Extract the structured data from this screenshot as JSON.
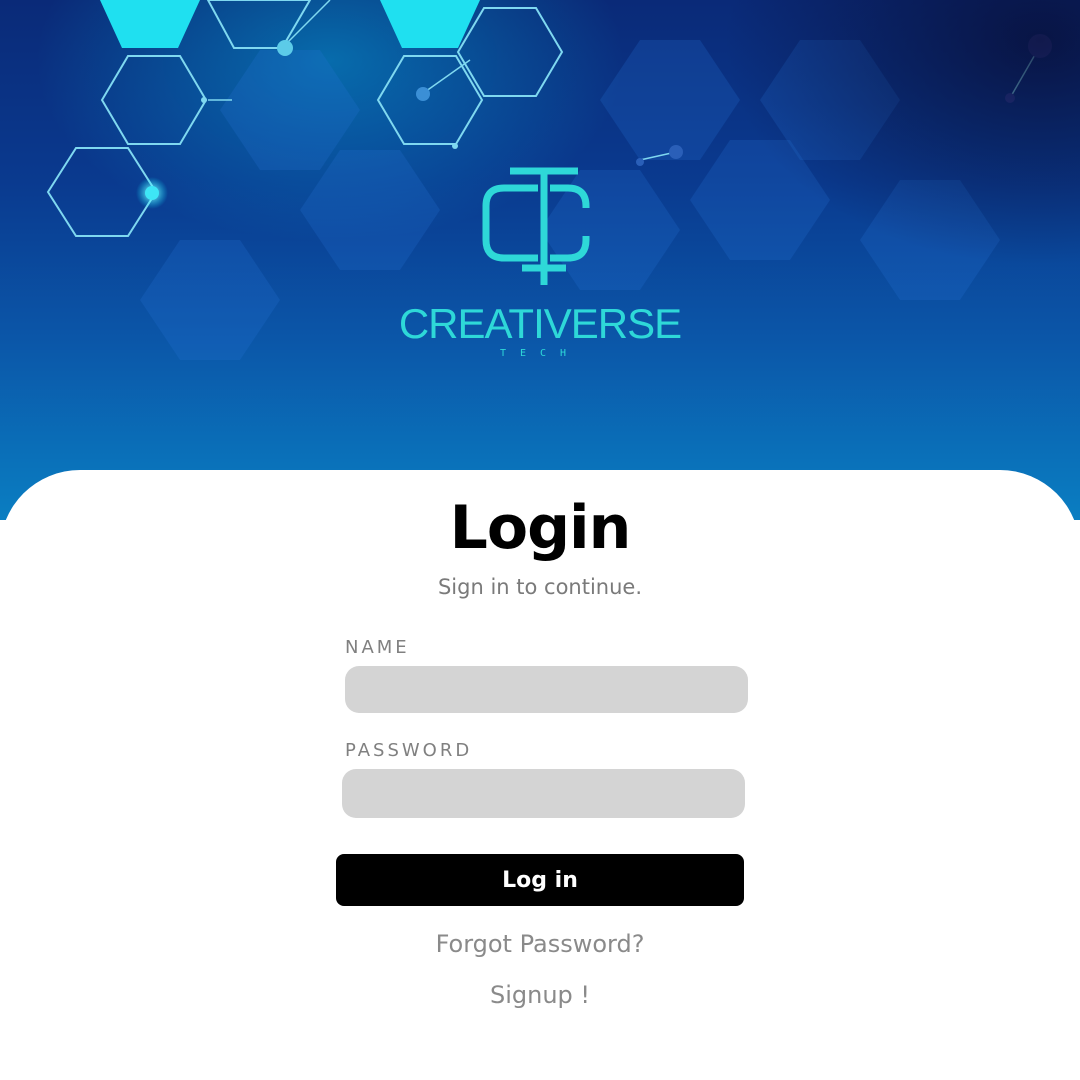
{
  "brand": {
    "name": "CREATIVERSE",
    "tagline": "TECH",
    "logo_icon": "ct-monogram-icon",
    "accent_color": "#2ed8d8"
  },
  "colors": {
    "hero_top": "#0a2a78",
    "hero_bottom": "#0a7ec2",
    "input_background": "#d4d4d4",
    "button_background": "#000000",
    "button_text": "#ffffff",
    "muted_text": "#808080"
  },
  "form": {
    "title": "Login",
    "subtitle": "Sign in to continue.",
    "name_label": "NAME",
    "name_value": "",
    "password_label": "PASSWORD",
    "password_value": "",
    "submit_label": "Log in"
  },
  "links": {
    "forgot_password": "Forgot Password?",
    "signup": "Signup !"
  }
}
